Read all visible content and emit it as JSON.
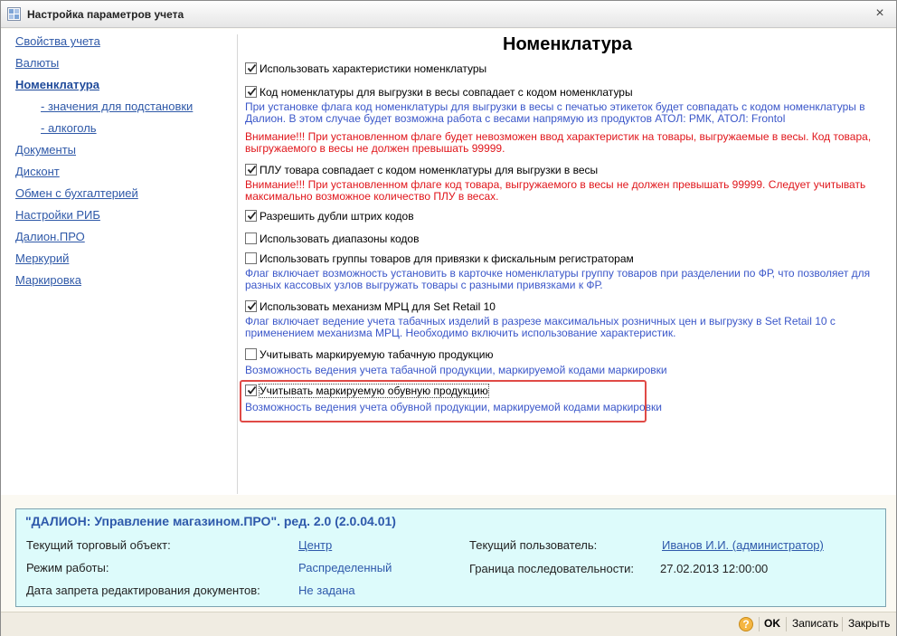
{
  "window": {
    "title": "Настройка параметров учета",
    "close": "×"
  },
  "nav": {
    "items": [
      {
        "label": "Свойства учета",
        "active": false
      },
      {
        "label": "Валюты",
        "active": false
      },
      {
        "label": "Номенклатура",
        "active": true
      },
      {
        "label": "- значения для подстановки",
        "active": false
      },
      {
        "label": "- алкоголь",
        "active": false
      },
      {
        "label": "Документы",
        "active": false
      },
      {
        "label": "Дисконт",
        "active": false
      },
      {
        "label": "Обмен с бухгалтерией",
        "active": false
      },
      {
        "label": "Настройки РИБ",
        "active": false
      },
      {
        "label": "Далион.ПРО",
        "active": false
      },
      {
        "label": "Меркурий",
        "active": false
      },
      {
        "label": "Маркировка",
        "active": false
      }
    ]
  },
  "main": {
    "title": "Номенклатура",
    "options": [
      {
        "label": "Использовать характеристики номенклатуры",
        "checked": true
      },
      {
        "label": "Код номенклатуры для выгрузки в весы совпадает с кодом номенклатуры",
        "checked": true
      },
      {
        "label": "ПЛУ товара совпадает с кодом номенклатуры для выгрузки в весы",
        "checked": true
      },
      {
        "label": "Разрешить дубли штрих кодов",
        "checked": true
      },
      {
        "label": "Использовать диапазоны кодов",
        "checked": false
      },
      {
        "label": "Использовать группы товаров для привязки к фискальным регистраторам",
        "checked": false
      },
      {
        "label": "Использовать механизм МРЦ для Set Retail 10",
        "checked": true
      },
      {
        "label": "Учитывать маркируемую табачную продукцию",
        "checked": false
      },
      {
        "label": "Учитывать маркируемую обувную продукцию",
        "checked": true
      }
    ],
    "hints": {
      "scales_hint": "При установке флага код номенклатуры для выгрузки в весы с печатью этикеток будет совпадать с кодом номенклатуры в Далион. В этом случае будет возможна работа с весами напрямую из продуктов АТОЛ: РМК, АТОЛ: Frontol",
      "scales_warn": "Внимание!!! При установленном флаге будет невозможен ввод характеристик на товары, выгружаемые в весы. Код товара, выгружаемого в весы не должен превышать 99999.",
      "plu_warn": "Внимание!!! При установленном флаге код товара, выгружаемого в весы не должен превышать 99999. Следует учитывать максимально возможное количество ПЛУ в весах.",
      "groups_hint": "Флаг включает возможность установить в карточке номенклатуры группу товаров при разделении по ФР, что позволяет для разных кассовых узлов выгружать товары с разными привязками к ФР.",
      "mrc_hint": "Флаг включает ведение учета табачных изделий в разрезе максимальных розничных цен и выгрузку в Set Retail 10 с применением механизма МРЦ. Необходимо включить использование характеристик.",
      "tobacco_hint": "Возможность ведения учета табачной продукции, маркируемой кодами маркировки",
      "shoes_hint": "Возможность ведения учета обувной продукции, маркируемой кодами маркировки"
    }
  },
  "info": {
    "title": "\"ДАЛИОН: Управление магазином.ПРО\". ред. 2.0 (2.0.04.01)",
    "store_label": "Текущий торговый объект:",
    "store_value": "Центр",
    "mode_label": "Режим работы:",
    "mode_value": "Распределенный",
    "lock_label": "Дата запрета редактирования документов:",
    "lock_value": "Не задана",
    "user_label": "Текущий пользователь:",
    "user_value": "Иванов И.И. (администратор)",
    "seq_label": "Граница последовательности:",
    "seq_value": "27.02.2013 12:00:00"
  },
  "footer": {
    "help": "?",
    "ok": "OK",
    "save": "Записать",
    "close": "Закрыть"
  },
  "colors": {
    "link": "#2f59a8",
    "hint": "#3b57c9",
    "warning": "#e0161b",
    "info_bg": "#ddfbfb",
    "highlight": "#e04a46"
  }
}
